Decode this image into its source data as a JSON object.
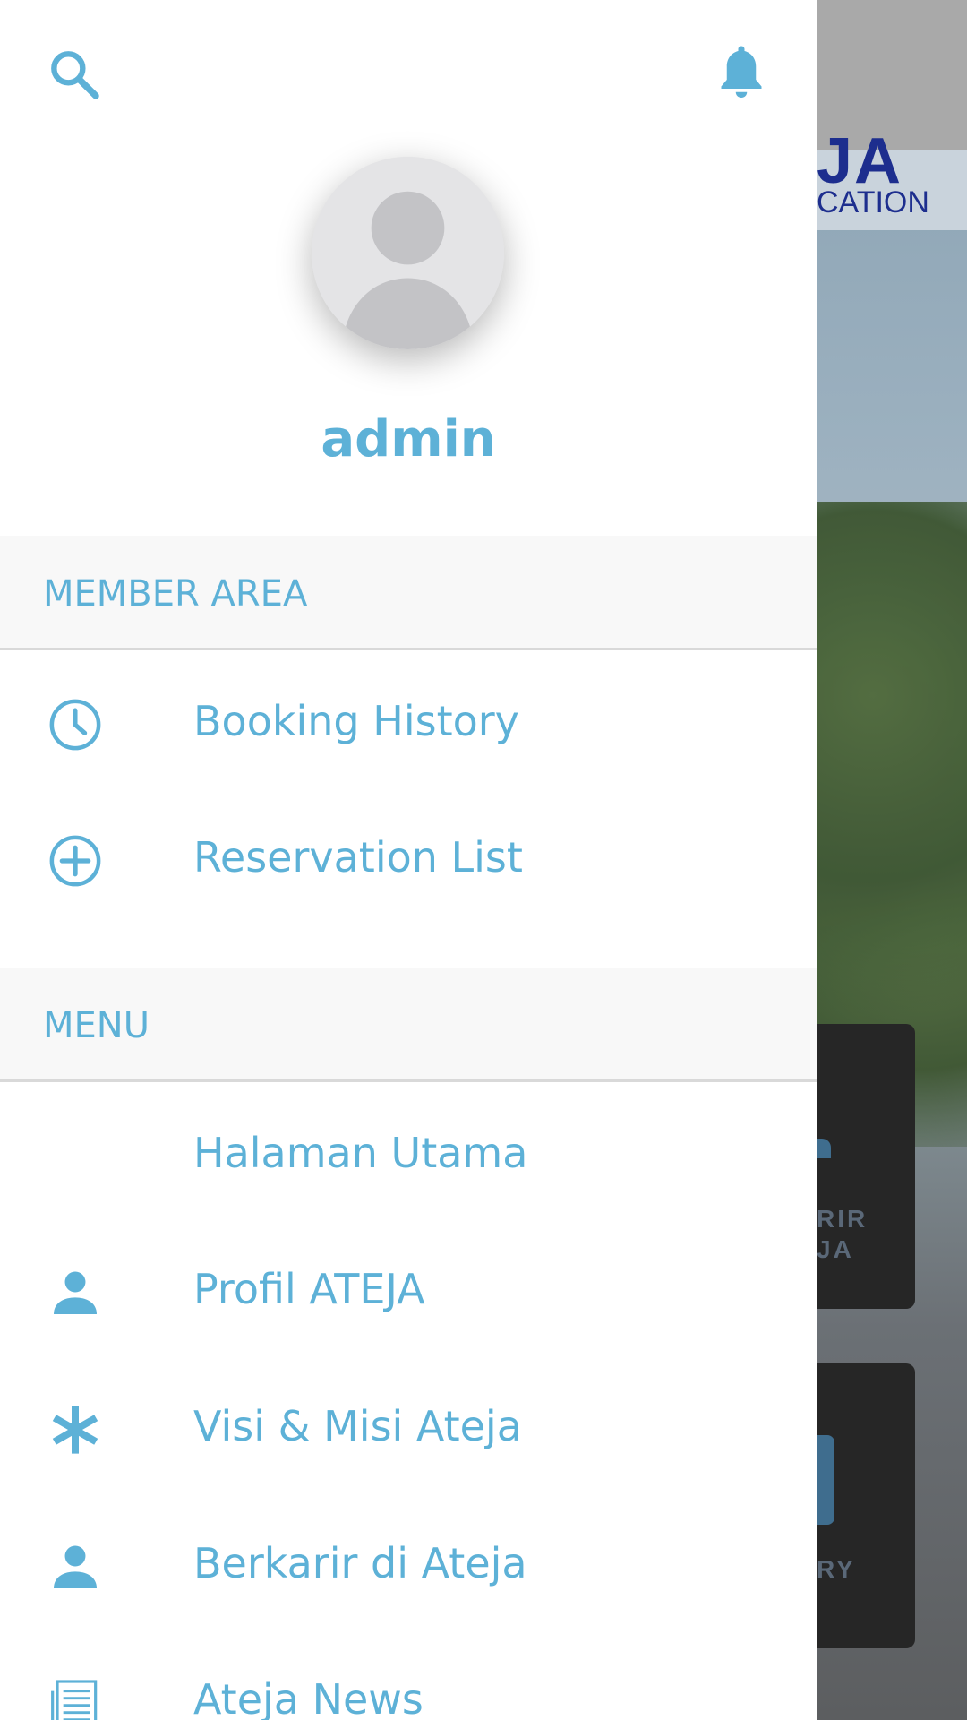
{
  "colors": {
    "accent": "#5db1d7",
    "drawer_bg": "#ffffff",
    "section_bg": "#f8f8f8"
  },
  "header": {
    "search_icon": "search-icon",
    "notification_icon": "bell-icon"
  },
  "profile": {
    "avatar": "default-user-avatar",
    "username": "admin"
  },
  "sections": {
    "member_area": {
      "title": "MEMBER AREA",
      "items": [
        {
          "icon": "clock-icon",
          "label": "Booking History"
        },
        {
          "icon": "plus-circle-icon",
          "label": "Reservation List"
        }
      ]
    },
    "menu": {
      "title": "MENU",
      "items": [
        {
          "icon": "",
          "label": "Halaman Utama"
        },
        {
          "icon": "person-icon",
          "label": "Profil ATEJA"
        },
        {
          "icon": "asterisk-icon",
          "label": "Visi & Misi Ateja"
        },
        {
          "icon": "person-icon",
          "label": "Berkarir di Ateja"
        },
        {
          "icon": "newspaper-icon",
          "label": "Ateja News"
        }
      ]
    }
  },
  "background": {
    "logo_big": "JA",
    "logo_small": "CATION",
    "card1_label_line1": "RIR",
    "card1_label_line2": "JA",
    "card2_label": "RY"
  }
}
